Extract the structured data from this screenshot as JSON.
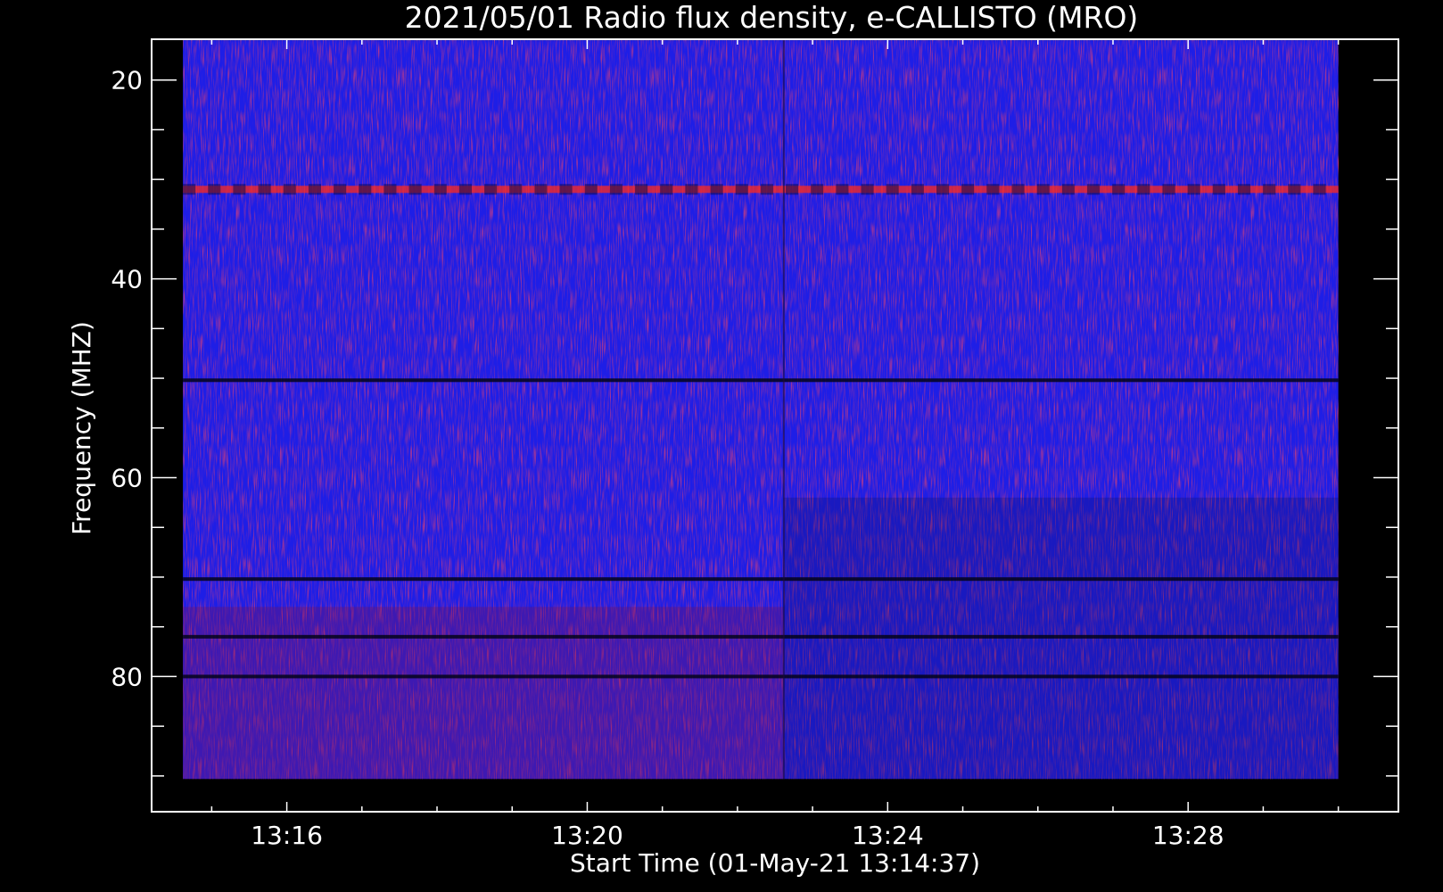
{
  "chart_data": {
    "type": "heatmap",
    "title": "2021/05/01  Radio flux density, e-CALLISTO (MRO)",
    "xlabel": "Start Time (01-May-21 13:14:37)",
    "ylabel": "Frequency (MHZ)",
    "x_start": "13:14:37",
    "x_end": "13:30:00",
    "x_ticks": [
      "13:16",
      "13:20",
      "13:24",
      "13:28"
    ],
    "x_tick_minutes": [
      16,
      20,
      24,
      28
    ],
    "xlim_minutes": [
      14.2,
      30.8
    ],
    "ylim_mhz": [
      15.9,
      93.6
    ],
    "y_axis_inverted": true,
    "y_ticks": [
      20,
      40,
      60,
      80
    ],
    "y_minor_step": 5,
    "freq_range_mhz": [
      16,
      90.3
    ],
    "colors": {
      "background": "#000000",
      "low": "#0a0a50",
      "mid": "#1e1ee6",
      "high": "#ff2a1a",
      "text": "#ffffff"
    },
    "features": [
      {
        "name": "bright band",
        "freq_mhz": 31,
        "color": "#ff2a1a"
      },
      {
        "name": "dark line",
        "freq_mhz": 50.2
      },
      {
        "name": "dark line",
        "freq_mhz": 70.2
      },
      {
        "name": "dark line",
        "freq_mhz": 76
      },
      {
        "name": "dark line",
        "freq_mhz": 80
      },
      {
        "name": "instrument switch",
        "time": "13:22:37"
      }
    ]
  }
}
